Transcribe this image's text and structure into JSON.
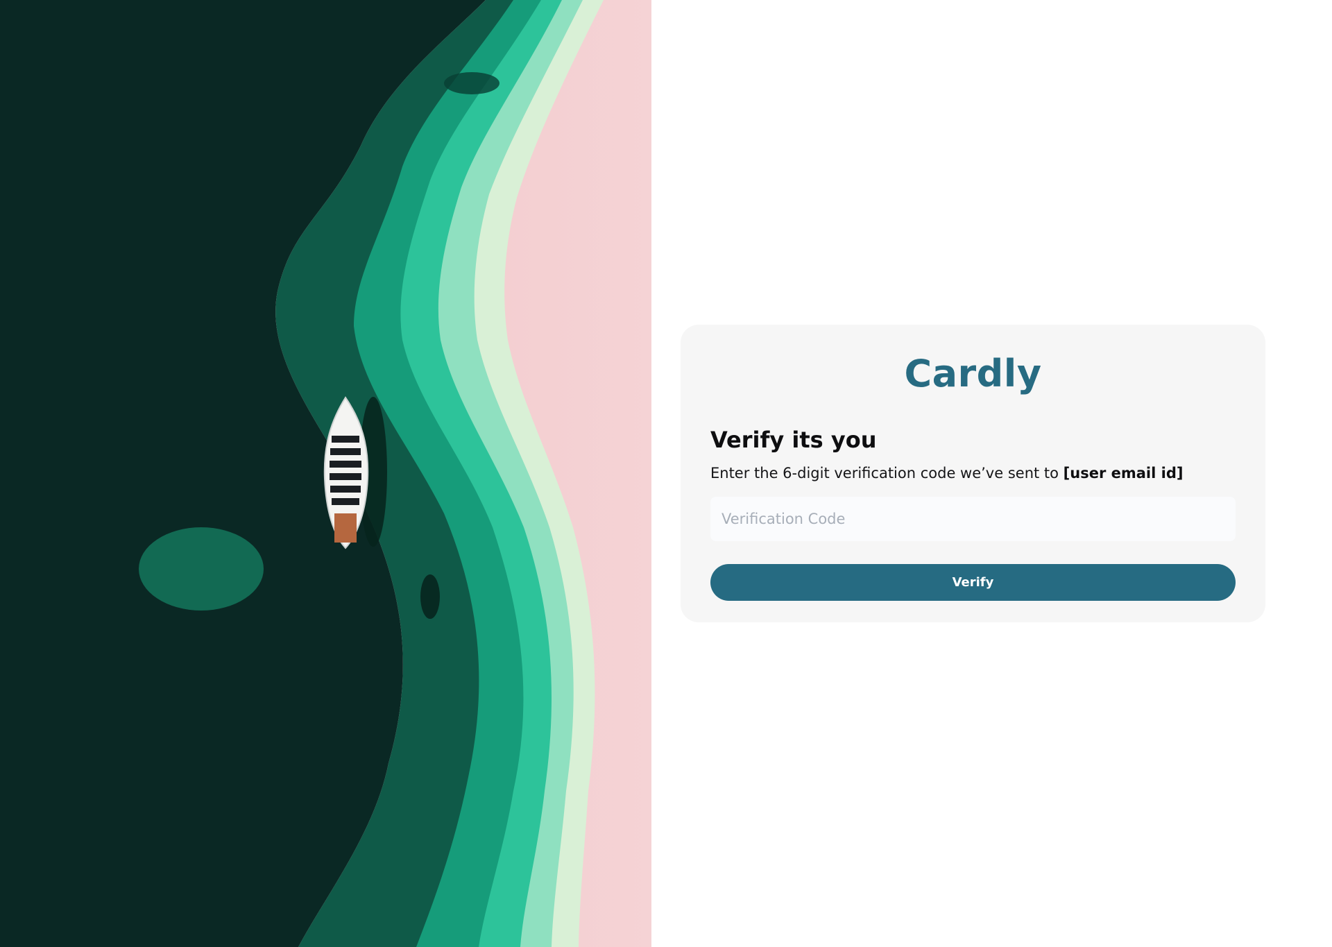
{
  "hero": {
    "image": "aerial-boat-ocean-pink-sand-photo"
  },
  "brand": {
    "name": "Cardly",
    "color": "#276b82"
  },
  "verify": {
    "title": "Verify its you",
    "subtitle_prefix": "Enter the 6-digit verification code we’ve sent to ",
    "subtitle_email": "[user email id]",
    "input_placeholder": "Verification Code",
    "input_value": "",
    "button_label": "Verify",
    "button_color": "#266b82"
  }
}
